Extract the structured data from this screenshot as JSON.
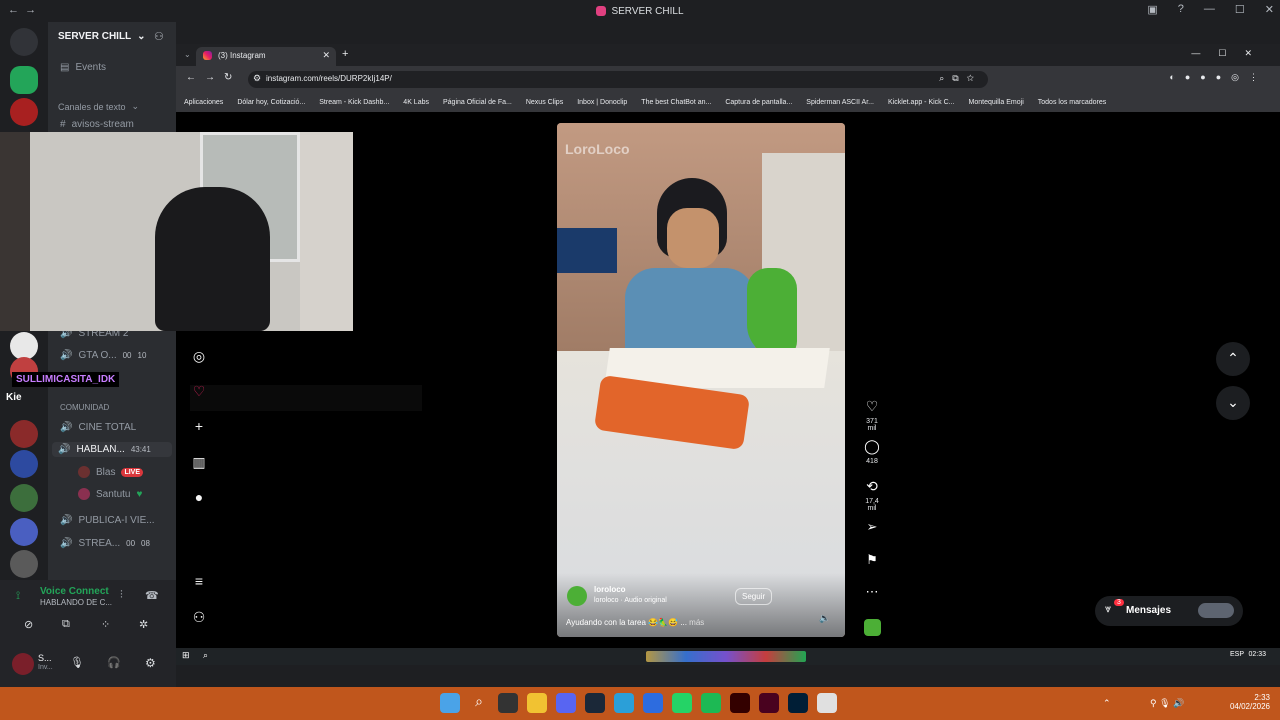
{
  "discord": {
    "window_title": "SERVER CHILL",
    "server_name": "SERVER CHILL",
    "events": "Events",
    "category_text": "Canales de texto",
    "channel_avisos": "avisos-stream",
    "voice_stream2": "STREAM 2",
    "voice_gta": "GTA O...",
    "voice_gta_count_a": "00",
    "voice_gta_count_b": "10",
    "streamer_tag": "SULLIMICASITA_IDK",
    "kie": "Kie",
    "category_comunidad": "COMUNIDAD",
    "voice_cine": "CINE TOTAL",
    "voice_hablan": "HABLAN...",
    "voice_hablan_time": "43:41",
    "user_blas": "Blas",
    "live_badge": "LIVE",
    "user_santutu": "Santutu",
    "voice_publica": "PUBLICA-I VIE...",
    "voice_strea": "STREA...",
    "voice_strea_count_a": "00",
    "voice_strea_count_b": "08",
    "voice_connected": "Voice Connect",
    "voice_connected_sub": "HABLANDO DE C...",
    "self_name": "S...",
    "self_status": "Inv..."
  },
  "browser": {
    "tab_title": "(3) Instagram",
    "url": "instagram.com/reels/DURP2kIj14P/",
    "bookmarks": [
      "Aplicaciones",
      "Dólar hoy, Cotizació...",
      "Stream - Kick Dashb...",
      "4K Labs",
      "Página Oficial de Fa...",
      "Nexus Clips",
      "Inbox | Donoclip",
      "The best ChatBot an...",
      "Captura de pantalla...",
      "Spiderman ASCII Ar...",
      "Kicklet.app - Kick C...",
      "Montequilla Emoji"
    ],
    "bookmarks_all": "Todos los marcadores"
  },
  "instagram": {
    "watermark": "LoroLoco",
    "likes": "371 mil",
    "comments": "418",
    "reposts": "17,4 mil",
    "username": "loroloco",
    "audio": "loroloco · Audio original",
    "follow_label": "Seguir",
    "caption": "Ayudando con la tarea 😂🦜😅 ...",
    "more": "más",
    "messages_label": "Mensajes",
    "messages_badge": "3"
  },
  "inner_taskbar": {
    "lang": "ESP",
    "time": "02:33"
  },
  "taskbar": {
    "time": "2:33",
    "date": "04/02/2026"
  }
}
